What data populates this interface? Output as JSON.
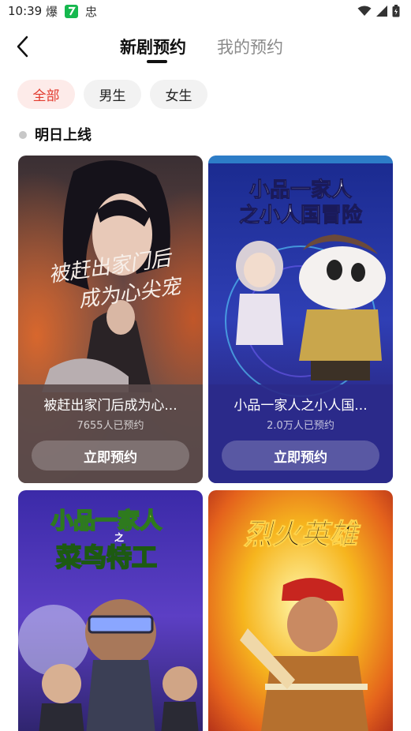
{
  "status_bar": {
    "time": "10:39",
    "icons": [
      "explode-notification-icon",
      "app-notification-icon",
      "chat-notification-icon",
      "wifi-icon",
      "signal-icon",
      "battery-icon"
    ],
    "note_glyphs": [
      "爆",
      "?",
      "忠"
    ]
  },
  "header": {
    "tabs": [
      {
        "label": "新剧预约",
        "active": true
      },
      {
        "label": "我的预约",
        "active": false
      }
    ]
  },
  "filters": [
    {
      "label": "全部",
      "active": true
    },
    {
      "label": "男生",
      "active": false
    },
    {
      "label": "女生",
      "active": false
    }
  ],
  "section": {
    "title": "明日上线"
  },
  "cards": [
    {
      "poster_text": [
        "被赶出家门后",
        "成为心尖宠"
      ],
      "title": "被赶出家门后成为心...",
      "subtitle": "7655人已预约",
      "button": "立即预约"
    },
    {
      "poster_text": [
        "小品一家人",
        "之小人国冒险"
      ],
      "title": "小品一家人之小人国...",
      "subtitle": "2.0万人已预约",
      "button": "立即预约"
    },
    {
      "poster_text": [
        "小品一家人",
        "之",
        "菜鸟特工"
      ]
    },
    {
      "poster_text": [
        "烈火英雄"
      ]
    }
  ],
  "colors": {
    "accent": "#e23b2e",
    "chip_active_bg": "#fdebe9",
    "card1_panel": "#5a4a4a",
    "card2_panel": "#2b2a8a"
  }
}
